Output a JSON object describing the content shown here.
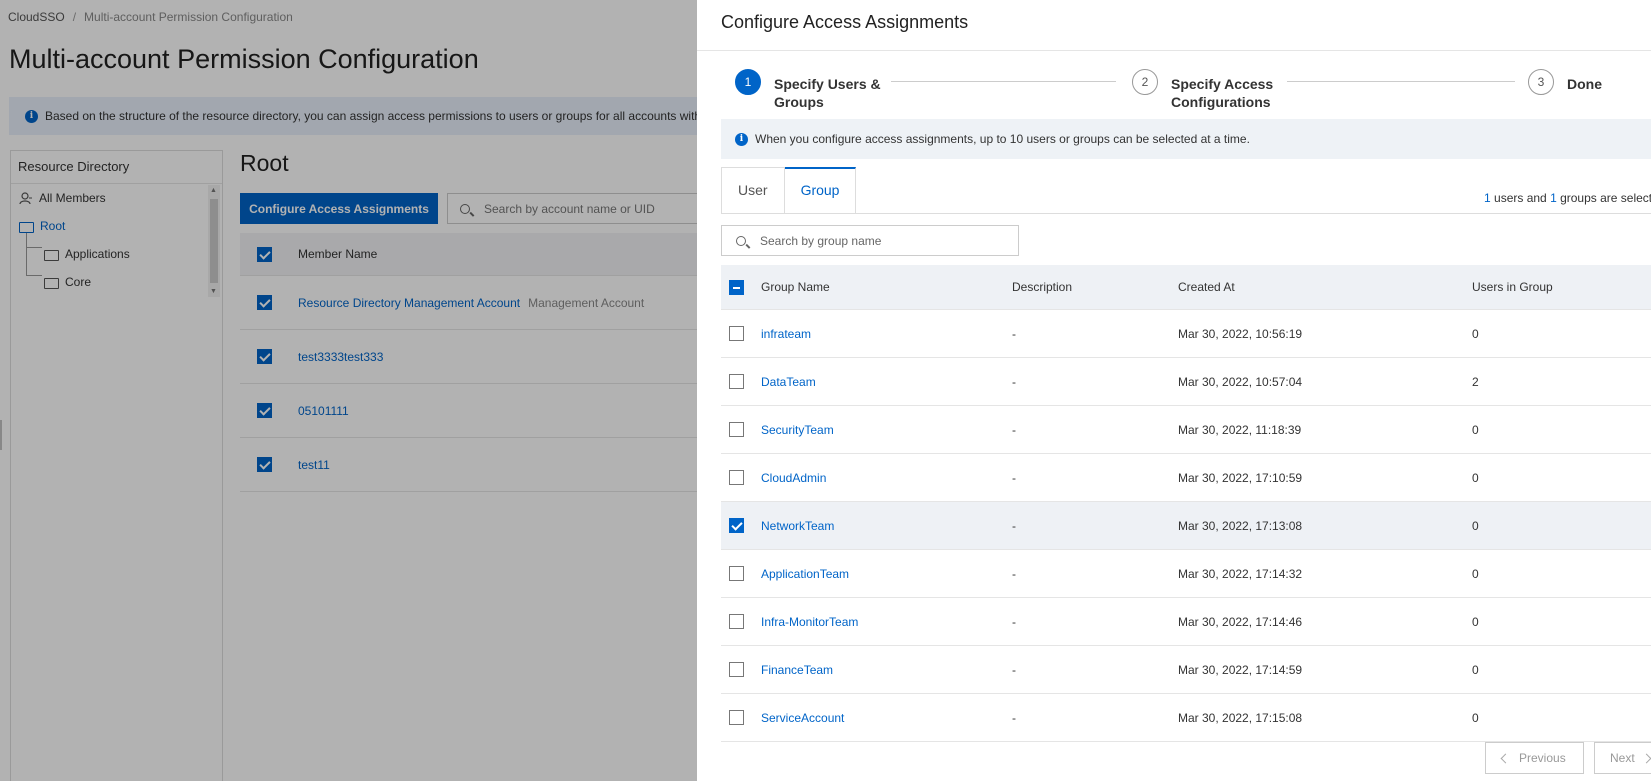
{
  "breadcrumb": {
    "root": "CloudSSO",
    "separator": "/",
    "current": "Multi-account Permission Configuration"
  },
  "page_title": "Multi-account Permission Configuration",
  "info_bar": "Based on the structure of the resource directory, you can assign access permissions to users or groups for all accounts withi",
  "tree": {
    "title": "Resource Directory",
    "all_members": "All Members",
    "root": "Root",
    "children": [
      "Applications",
      "Core"
    ]
  },
  "main": {
    "title": "Root",
    "configure_button": "Configure Access Assignments",
    "search_placeholder": "Search by account name or UID",
    "column_member_name": "Member Name",
    "rows": [
      {
        "name": "Resource Directory Management Account",
        "tag": "Management Account",
        "checked": true
      },
      {
        "name": "test3333test333",
        "tag": "",
        "checked": true
      },
      {
        "name": "05101111",
        "tag": "",
        "checked": true
      },
      {
        "name": "test11",
        "tag": "",
        "checked": true
      }
    ]
  },
  "drawer": {
    "title": "Configure Access Assignments",
    "steps": [
      {
        "num": "1",
        "label": "Specify Users &\nGroups",
        "active": true
      },
      {
        "num": "2",
        "label": "Specify Access\nConfigurations",
        "active": false
      },
      {
        "num": "3",
        "label": "Done",
        "active": false
      }
    ],
    "info": "When you configure access assignments, up to 10 users or groups can be selected at a time.",
    "tabs": [
      "User",
      "Group"
    ],
    "active_tab": "Group",
    "selection": {
      "users": "1",
      "users_text": " users and ",
      "groups": "1",
      "groups_text": " groups are selecte"
    },
    "search_placeholder": "Search by group name",
    "columns": {
      "name": "Group Name",
      "description": "Description",
      "created": "Created At",
      "users": "Users in Group"
    },
    "groups": [
      {
        "name": "infrateam",
        "description": "-",
        "created": "Mar 30, 2022, 10:56:19",
        "users": "0",
        "checked": false
      },
      {
        "name": "DataTeam",
        "description": "-",
        "created": "Mar 30, 2022, 10:57:04",
        "users": "2",
        "checked": false
      },
      {
        "name": "SecurityTeam",
        "description": "-",
        "created": "Mar 30, 2022, 11:18:39",
        "users": "0",
        "checked": false
      },
      {
        "name": "CloudAdmin",
        "description": "-",
        "created": "Mar 30, 2022, 17:10:59",
        "users": "0",
        "checked": false
      },
      {
        "name": "NetworkTeam",
        "description": "-",
        "created": "Mar 30, 2022, 17:13:08",
        "users": "0",
        "checked": true
      },
      {
        "name": "ApplicationTeam",
        "description": "-",
        "created": "Mar 30, 2022, 17:14:32",
        "users": "0",
        "checked": false
      },
      {
        "name": "Infra-MonitorTeam",
        "description": "-",
        "created": "Mar 30, 2022, 17:14:46",
        "users": "0",
        "checked": false
      },
      {
        "name": "FinanceTeam",
        "description": "-",
        "created": "Mar 30, 2022, 17:14:59",
        "users": "0",
        "checked": false
      },
      {
        "name": "ServiceAccount",
        "description": "-",
        "created": "Mar 30, 2022, 17:15:08",
        "users": "0",
        "checked": false
      }
    ],
    "previous_button": "Previous",
    "next_button": "Next"
  },
  "colors": {
    "accent": "#0064c8",
    "overlay": "rgba(0,0,0,0.30)"
  }
}
